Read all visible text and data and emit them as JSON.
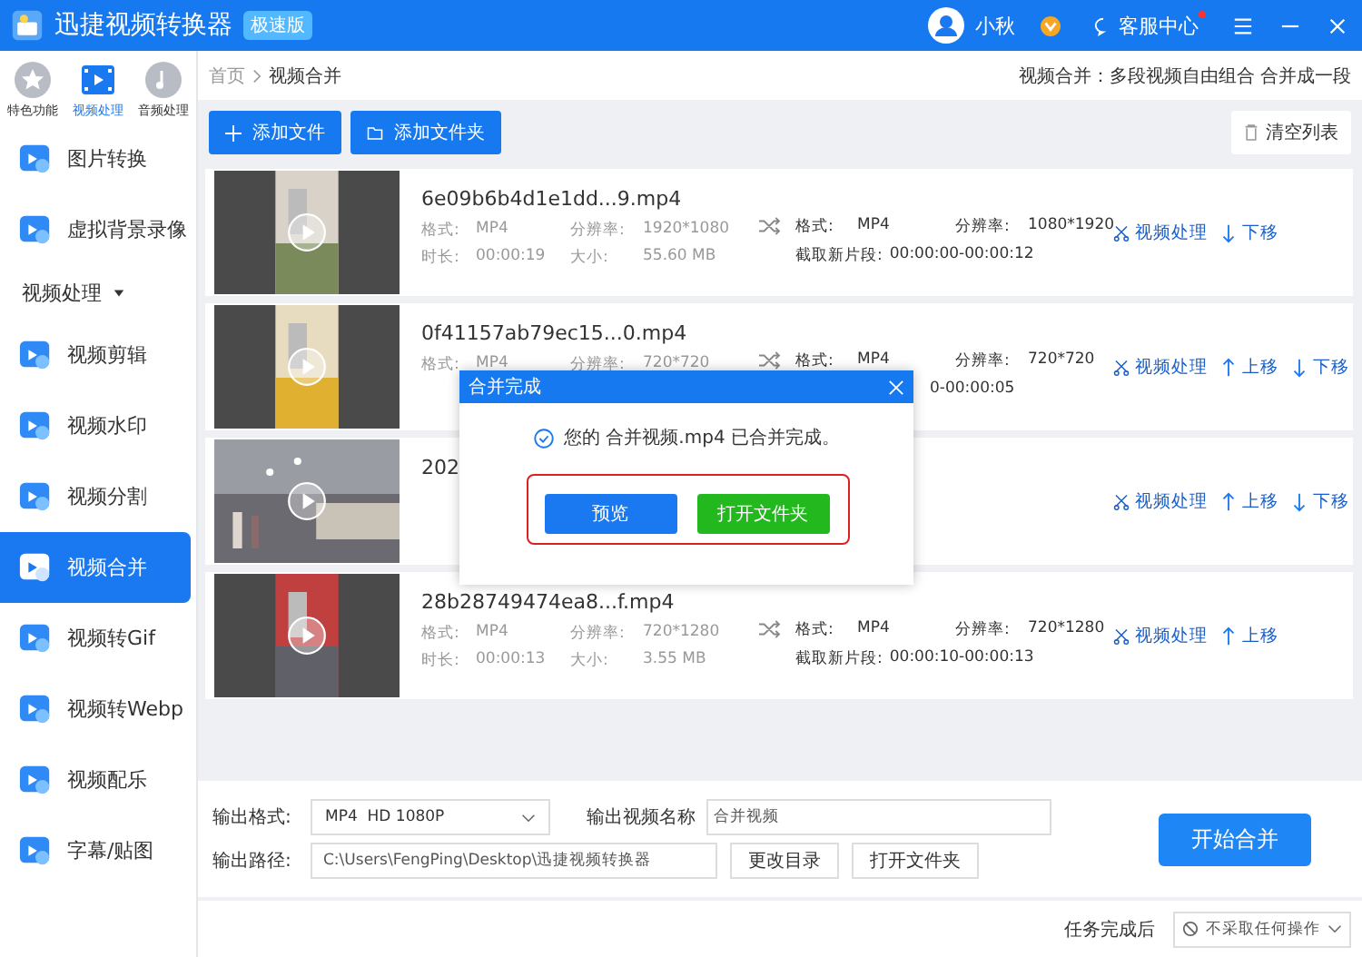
{
  "window": {
    "title": "迅捷视频转换器",
    "edition_badge": "极速版",
    "user_name": "小秋",
    "support_label": "客服中心",
    "support_unread": true
  },
  "mode_tabs": [
    {
      "label": "特色功能",
      "selected": false
    },
    {
      "label": "视频处理",
      "selected": true
    },
    {
      "label": "音频处理",
      "selected": false
    }
  ],
  "sidebar": {
    "items": [
      {
        "kind": "item",
        "label": "图片转换",
        "selected": false
      },
      {
        "kind": "item",
        "label": "虚拟背景录像",
        "selected": false
      },
      {
        "kind": "section",
        "label": "视频处理",
        "expanded": true
      },
      {
        "kind": "item",
        "label": "视频剪辑",
        "selected": false
      },
      {
        "kind": "item",
        "label": "视频水印",
        "selected": false
      },
      {
        "kind": "item",
        "label": "视频分割",
        "selected": false
      },
      {
        "kind": "item",
        "label": "视频合并",
        "selected": true
      },
      {
        "kind": "item",
        "label": "视频转Gif",
        "selected": false
      },
      {
        "kind": "item",
        "label": "视频转Webp",
        "selected": false
      },
      {
        "kind": "item",
        "label": "视频配乐",
        "selected": false
      },
      {
        "kind": "item",
        "label": "字幕/贴图",
        "selected": false
      }
    ]
  },
  "breadcrumb": [
    "首页",
    "视频合并"
  ],
  "page_hint": "视频合并：多段视频自由组合 合并成一段",
  "toolbar": {
    "add_file": "添加文件",
    "add_folder": "添加文件夹",
    "clear": "清空列表"
  },
  "files": [
    {
      "name": "6e09b6b4d1e1dd...9.mp4",
      "source": [
        {
          "label": "格式:",
          "value": "MP4"
        },
        {
          "label": "分辨率:",
          "value": "1920*1080"
        },
        {
          "label": "时长:",
          "value": "00:00:19"
        },
        {
          "label": "大小:",
          "value": "55.60 MB"
        }
      ],
      "output": [
        {
          "label": "格式:",
          "value": "MP4"
        },
        {
          "label": "分辨率:",
          "value": "1080*1920"
        },
        {
          "label": "截取新片段:",
          "value": "00:00:00-00:00:12"
        }
      ],
      "actions": [
        {
          "kind": "edit",
          "label": "视频处理"
        },
        {
          "kind": "down",
          "label": "下移"
        }
      ]
    },
    {
      "name": "0f41157ab79ec15...0.mp4",
      "source": [
        {
          "label": "格式:",
          "value": "MP4"
        },
        {
          "label": "分辨率:",
          "value": "720*720"
        }
      ],
      "output": [
        {
          "label": "格式:",
          "value": "MP4"
        },
        {
          "label": "分辨率:",
          "value": "720*720"
        },
        {
          "value": "0-00:00:05"
        }
      ],
      "actions": [
        {
          "kind": "edit",
          "label": "视频处理"
        },
        {
          "kind": "up",
          "label": "上移"
        },
        {
          "kind": "down",
          "label": "下移"
        }
      ]
    },
    {
      "name": "202",
      "actions": [
        {
          "kind": "edit",
          "label": "视频处理"
        },
        {
          "kind": "up",
          "label": "上移"
        },
        {
          "kind": "down",
          "label": "下移"
        }
      ]
    },
    {
      "name": "28b28749474ea8...f.mp4",
      "source": [
        {
          "label": "格式:",
          "value": "MP4"
        },
        {
          "label": "分辨率:",
          "value": "720*1280"
        },
        {
          "label": "时长:",
          "value": "00:00:13"
        },
        {
          "label": "大小:",
          "value": "3.55 MB"
        }
      ],
      "output": [
        {
          "label": "格式:",
          "value": "MP4"
        },
        {
          "label": "分辨率:",
          "value": "720*1280"
        },
        {
          "label": "截取新片段:",
          "value": "00:00:10-00:00:13"
        }
      ],
      "actions": [
        {
          "kind": "edit",
          "label": "视频处理"
        },
        {
          "kind": "up",
          "label": "上移"
        }
      ]
    }
  ],
  "output_settings": {
    "format_label": "输出格式:",
    "format_value": "MP4  HD 1080P",
    "name_label": "输出视频名称",
    "name_value": "合并视频",
    "path_label": "输出路径:",
    "path_value": "C:\\Users\\FengPing\\Desktop\\迅捷视频转换器",
    "change_dir": "更改目录",
    "open_folder": "打开文件夹",
    "start": "开始合并"
  },
  "footer": {
    "label": "任务完成后",
    "select_value": "不采取任何操作"
  },
  "dialog": {
    "title": "合并完成",
    "message": "您的 合并视频.mp4 已合并完成。",
    "buttons": [
      {
        "kind": "primary",
        "label": "预览"
      },
      {
        "kind": "success",
        "label": "打开文件夹"
      }
    ]
  }
}
